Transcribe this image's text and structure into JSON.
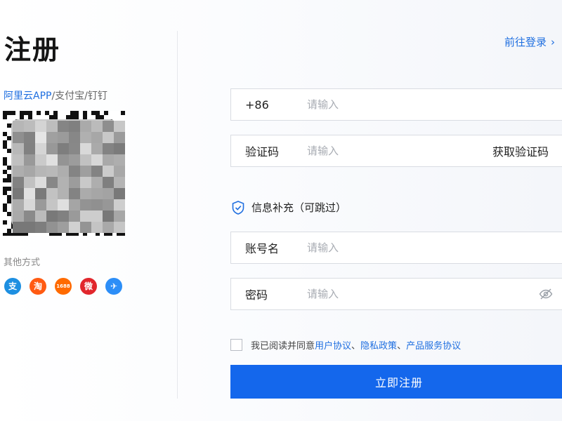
{
  "header": {
    "title": "注册",
    "login_link": "前往登录",
    "login_chevron": "›"
  },
  "qr_section": {
    "apps_highlight": "阿里云APP",
    "apps_rest": "/支付宝/钉钉"
  },
  "other_methods": {
    "label": "其他方式",
    "providers": [
      {
        "name": "alipay",
        "glyph": "支"
      },
      {
        "name": "taobao",
        "glyph": "淘"
      },
      {
        "name": "1688",
        "glyph": "1688"
      },
      {
        "name": "weibo",
        "glyph": "微"
      },
      {
        "name": "dingtalk",
        "glyph": "✈"
      }
    ]
  },
  "form": {
    "phone": {
      "prefix": "+86",
      "placeholder": "请输入"
    },
    "code": {
      "label": "验证码",
      "placeholder": "请输入",
      "action": "获取验证码"
    },
    "section_title": "信息补充（可跳过）",
    "account": {
      "label": "账号名",
      "placeholder": "请输入"
    },
    "password": {
      "label": "密码",
      "placeholder": "请输入"
    }
  },
  "agreement": {
    "prefix": "我已阅读并同意 ",
    "user_agreement": "用户协议",
    "separator": "、",
    "privacy_policy": "隐私政策",
    "service_agreement": "产品服务协议"
  },
  "submit_label": "立即注册",
  "colors": {
    "accent": "#1467ec",
    "link": "#1f6fe0"
  }
}
